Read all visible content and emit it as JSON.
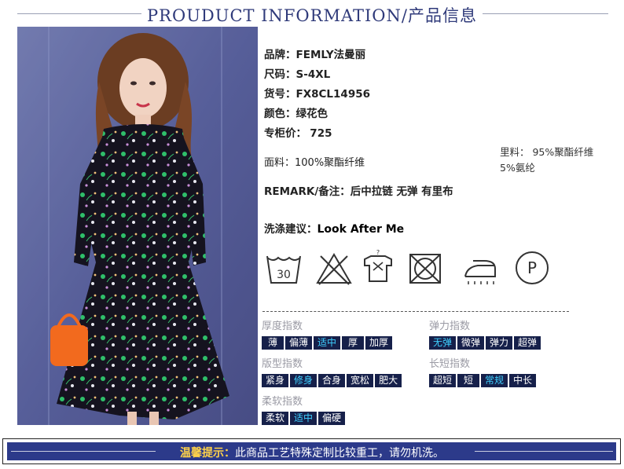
{
  "header": {
    "title": "PROUDUCT INFORMATION/产品信息"
  },
  "product": {
    "brand": "品牌：FEMLY法曼丽",
    "size": "尺码：S-4XL",
    "item_no": "货号：FX8CL14956",
    "color": "颜色：绿花色",
    "price_label": "专柜价：",
    "price_value": "725",
    "fabric": "面料：100%聚酯纤维",
    "lining_line1": "里料： 95%聚酯纤维",
    "lining_line2": "5%氨纶",
    "remark": "REMARK/备注：后中拉链 无弹 有里布",
    "wash_label": "洗涤建议：",
    "wash_value": "Look After Me"
  },
  "care_icons": [
    {
      "name": "wash-30-icon",
      "label": "30"
    },
    {
      "name": "no-bleach-icon",
      "label": ""
    },
    {
      "name": "no-tumble-dry-icon",
      "label": ""
    },
    {
      "name": "no-dry-icon",
      "label": ""
    },
    {
      "name": "iron-icon",
      "label": ""
    },
    {
      "name": "dry-clean-p-icon",
      "label": "P"
    }
  ],
  "attributes": {
    "thickness": {
      "title": "厚度指数",
      "options": [
        "薄",
        "偏薄",
        "适中",
        "厚",
        "加厚"
      ],
      "selected": "适中"
    },
    "elasticity": {
      "title": "弹力指数",
      "options": [
        "无弹",
        "微弹",
        "弹力",
        "超弹"
      ],
      "selected": "无弹"
    },
    "fit": {
      "title": "版型指数",
      "options": [
        "紧身",
        "修身",
        "合身",
        "宽松",
        "肥大"
      ],
      "selected": "修身"
    },
    "length": {
      "title": "长短指数",
      "options": [
        "超短",
        "短",
        "常规",
        "中长"
      ],
      "selected": "常规"
    },
    "softness": {
      "title": "柔软指数",
      "options": [
        "柔软",
        "适中",
        "偏硬"
      ],
      "selected": "适中"
    }
  },
  "footer": {
    "warm_label": "温馨提示：",
    "text": "此商品工艺特殊定制比较重工，请勿机洗。"
  },
  "colors": {
    "navy": "#16204a",
    "accent_selected": "#3fd0ff",
    "footer_bar": "#2c3a8a",
    "warm": "#ffd24a",
    "title": "#2f3a7a"
  }
}
